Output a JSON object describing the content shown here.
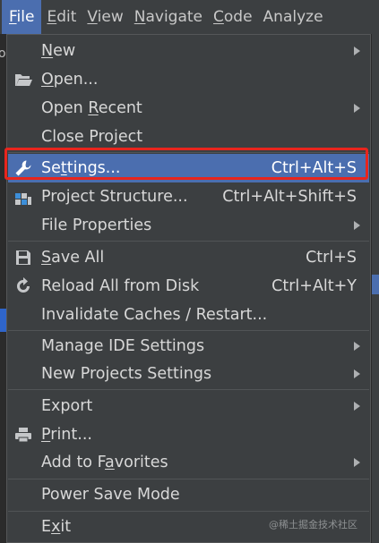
{
  "menubar": {
    "items": [
      {
        "label": "File",
        "u": "F",
        "rest": "ile",
        "active": true
      },
      {
        "label": "Edit",
        "u": "E",
        "rest": "dit"
      },
      {
        "label": "View",
        "u": "V",
        "rest": "iew"
      },
      {
        "label": "Navigate",
        "u": "N",
        "rest": "avigate"
      },
      {
        "label": "Code",
        "u": "C",
        "rest": "ode"
      },
      {
        "label": "Analyze",
        "u": "",
        "rest": "Analyze"
      }
    ]
  },
  "file_menu": {
    "new": {
      "pre": "",
      "u": "N",
      "post": "ew",
      "submenu": true
    },
    "open": {
      "pre": "",
      "u": "O",
      "post": "pen...",
      "icon": "folder-icon"
    },
    "open_recent": {
      "pre": "Open ",
      "u": "R",
      "post": "ecent",
      "submenu": true
    },
    "close_project": {
      "pre": "Close Project",
      "u": "",
      "post": ""
    },
    "settings": {
      "pre": "Se",
      "u": "t",
      "post": "tings...",
      "shortcut": "Ctrl+Alt+S",
      "icon": "wrench-icon",
      "selected": true
    },
    "project_structure": {
      "pre": "Project Structure...",
      "u": "",
      "post": "",
      "shortcut": "Ctrl+Alt+Shift+S",
      "icon": "project-structure-icon"
    },
    "file_properties": {
      "pre": "File Properties",
      "u": "",
      "post": "",
      "submenu": true
    },
    "save_all": {
      "pre": "",
      "u": "S",
      "post": "ave All",
      "shortcut": "Ctrl+S",
      "icon": "save-icon"
    },
    "reload_all": {
      "pre": "Reload All from Disk",
      "u": "",
      "post": "",
      "shortcut": "Ctrl+Alt+Y",
      "icon": "reload-icon"
    },
    "invalidate_caches": {
      "pre": "Invalidate Caches / Restart...",
      "u": "",
      "post": ""
    },
    "manage_ide_settings": {
      "pre": "Manage IDE Settings",
      "u": "",
      "post": "",
      "submenu": true
    },
    "new_projects_settings": {
      "pre": "New Projects Settings",
      "u": "",
      "post": "",
      "submenu": true
    },
    "export": {
      "pre": "Export",
      "u": "",
      "post": "",
      "submenu": true
    },
    "print": {
      "pre": "",
      "u": "P",
      "post": "rint...",
      "icon": "printer-icon"
    },
    "add_to_favorites": {
      "pre": "Add to F",
      "u": "a",
      "post": "vorites",
      "submenu": true
    },
    "power_save_mode": {
      "pre": "Power Save Mode",
      "u": "",
      "post": ""
    },
    "exit": {
      "pre": "E",
      "u": "x",
      "post": "it"
    }
  },
  "watermark": "@稀土掘金技术社区",
  "colors": {
    "selection": "#4b6eaf",
    "highlight_border": "#e8251d",
    "menu_bg": "#3c3f41"
  }
}
